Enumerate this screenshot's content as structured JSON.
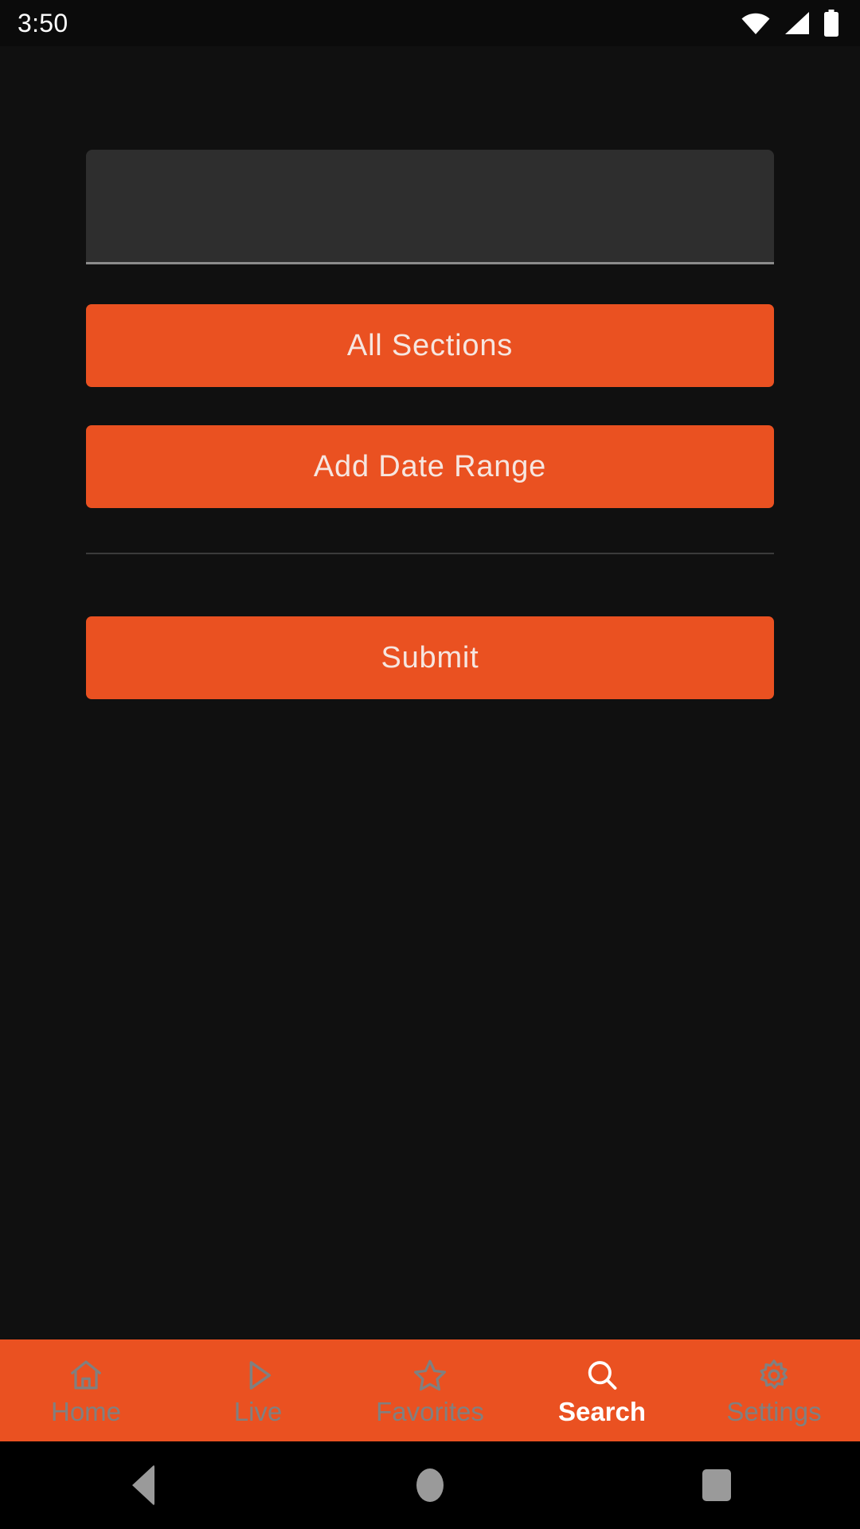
{
  "status_bar": {
    "time": "3:50",
    "icons": [
      "wifi-icon",
      "cellular-signal-icon",
      "battery-icon"
    ]
  },
  "screen": {
    "title": "Search",
    "background_color": "#101010",
    "accent_color": "#EA5121"
  },
  "search_form": {
    "query_field": {
      "value": "",
      "placeholder": "",
      "background_color": "#2e2e2e",
      "underline_color": "#8c8c8c"
    },
    "sections_button": {
      "label": "All Sections"
    },
    "date_range_button": {
      "label": "Add Date Range"
    },
    "submit_button": {
      "label": "Submit"
    }
  },
  "tab_bar": {
    "background_color": "#EA5121",
    "active_color": "#ffffff",
    "inactive_color": "#808080",
    "items": [
      {
        "label": "Home",
        "icon": "home-icon",
        "active": false
      },
      {
        "label": "Live",
        "icon": "play-icon",
        "active": false
      },
      {
        "label": "Favorites",
        "icon": "star-icon",
        "active": false
      },
      {
        "label": "Search",
        "icon": "search-icon",
        "active": true
      },
      {
        "label": "Settings",
        "icon": "gear-icon",
        "active": false
      }
    ]
  },
  "system_nav": {
    "back": "back-button",
    "home": "home-button",
    "recents": "recents-button"
  }
}
